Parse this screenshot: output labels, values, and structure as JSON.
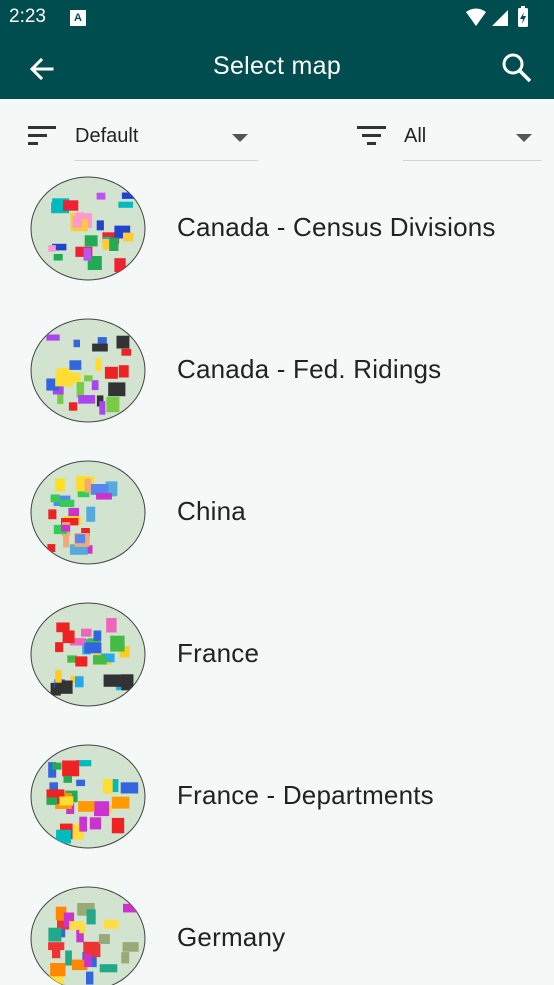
{
  "status_bar": {
    "time": "2:23",
    "notification_glyph": "A"
  },
  "app_bar": {
    "title": "Select map"
  },
  "filters": {
    "sort_value": "Default",
    "filter_value": "All"
  },
  "maps": [
    {
      "label": "Canada - Census Divisions",
      "colors": [
        "#e23",
        "#2a5",
        "#f9c",
        "#24c",
        "#fc3",
        "#b5e",
        "#0bb"
      ]
    },
    {
      "label": "Canada - Fed. Ridings",
      "colors": [
        "#a4e",
        "#333",
        "#fd3",
        "#e22",
        "#36d",
        "#7c4"
      ]
    },
    {
      "label": "China",
      "colors": [
        "#e22",
        "#5ad",
        "#ea7",
        "#3c5",
        "#c3c",
        "#fd2",
        "#58e"
      ]
    },
    {
      "label": "France",
      "colors": [
        "#fc2",
        "#2ae",
        "#e22",
        "#333",
        "#4b4",
        "#e6b",
        "#36d"
      ]
    },
    {
      "label": "France - Departments",
      "colors": [
        "#e22",
        "#2a5",
        "#36d",
        "#fd3",
        "#c3c",
        "#0bb",
        "#f90"
      ]
    },
    {
      "label": "Germany",
      "colors": [
        "#fd4",
        "#e33",
        "#9a7",
        "#c3c",
        "#2a8",
        "#36d",
        "#f80"
      ]
    }
  ]
}
